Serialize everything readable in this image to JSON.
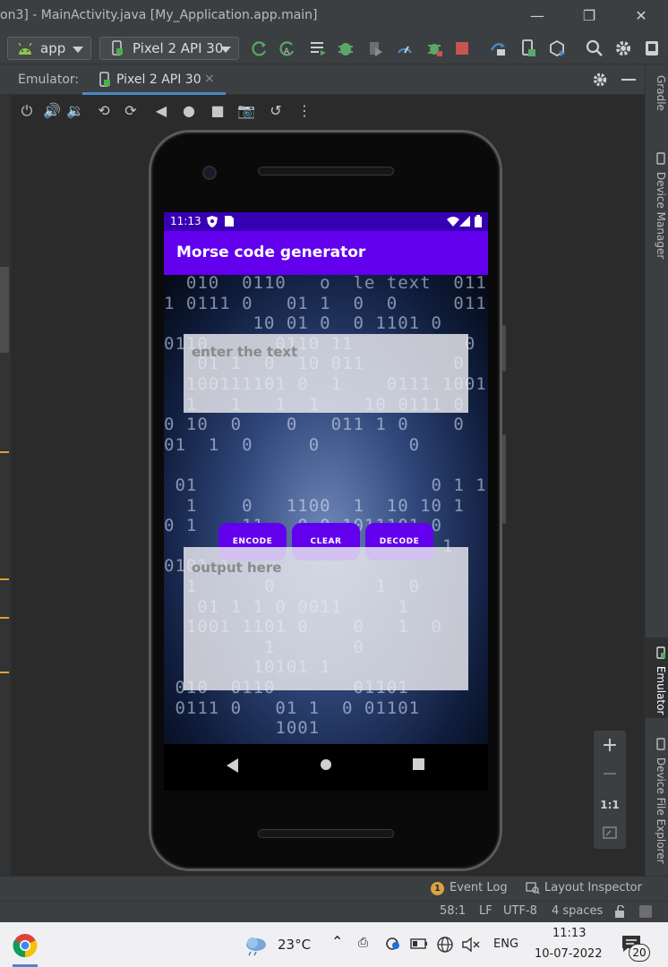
{
  "window": {
    "title": "on3] - MainActivity.java [My_Application.app.main]"
  },
  "toolbar": {
    "module": "app",
    "device": "Pixel 2 API 30"
  },
  "emulator_panel": {
    "label": "Emulator:",
    "tab": "Pixel 2 API 30",
    "tab_close": "×"
  },
  "side_tabs": {
    "gradle": "Gradle",
    "device_manager": "Device Manager",
    "emulator": "Emulator",
    "device_file_explorer": "Device File Explorer"
  },
  "zoom": {
    "zoom_in": "+",
    "zoom_out": "−",
    "actual_size": "1:1"
  },
  "phone": {
    "status_time": "11:13",
    "app_title": "Morse code generator",
    "background_label": "le text",
    "input_placeholder": "enter the text",
    "output_placeholder": "output here",
    "buttons": {
      "encode": "ENCODE",
      "clear": "CLEAR",
      "decode": "DECODE"
    },
    "binary_rows": [
      "  010  0110   o  le text  01101",
      "1 0111 0   01 1  0  0     01101",
      "        10 01 0  0 1101 0",
      "0110      0110 11          0 1 0",
      "   01 1  0  10 011        0",
      "  100111101 0  1    0111 10010",
      "  1   1   1  1    10 0111 0",
      "0 10  0    0   011 1 0    0  1 0",
      "01  1  0     0        0      01",
      "",
      " 01                     0 1 1",
      "  1    0   1100  1  10 10 1",
      "0 1    11   0 0 1011101 0",
      "     1             0 101 1",
      "0101 1",
      "  1      0         1  0",
      "   01 1 1 0 0011     1",
      "  1001 1101 0    0   1  0",
      "         1       0",
      "        10101 1",
      " 010  0110       01101",
      " 0111 0   01 1  0 01101",
      "          1001"
    ]
  },
  "statusbar": {
    "event_log_count": "1",
    "event_log": "Event Log",
    "layout_inspector": "Layout Inspector",
    "position": "58:1",
    "line_sep": "LF",
    "encoding": "UTF-8",
    "indent": "4 spaces"
  },
  "taskbar": {
    "temperature": "23°C",
    "language": "ENG",
    "time": "11:13",
    "date": "10-07-2022",
    "notifications": "20"
  }
}
